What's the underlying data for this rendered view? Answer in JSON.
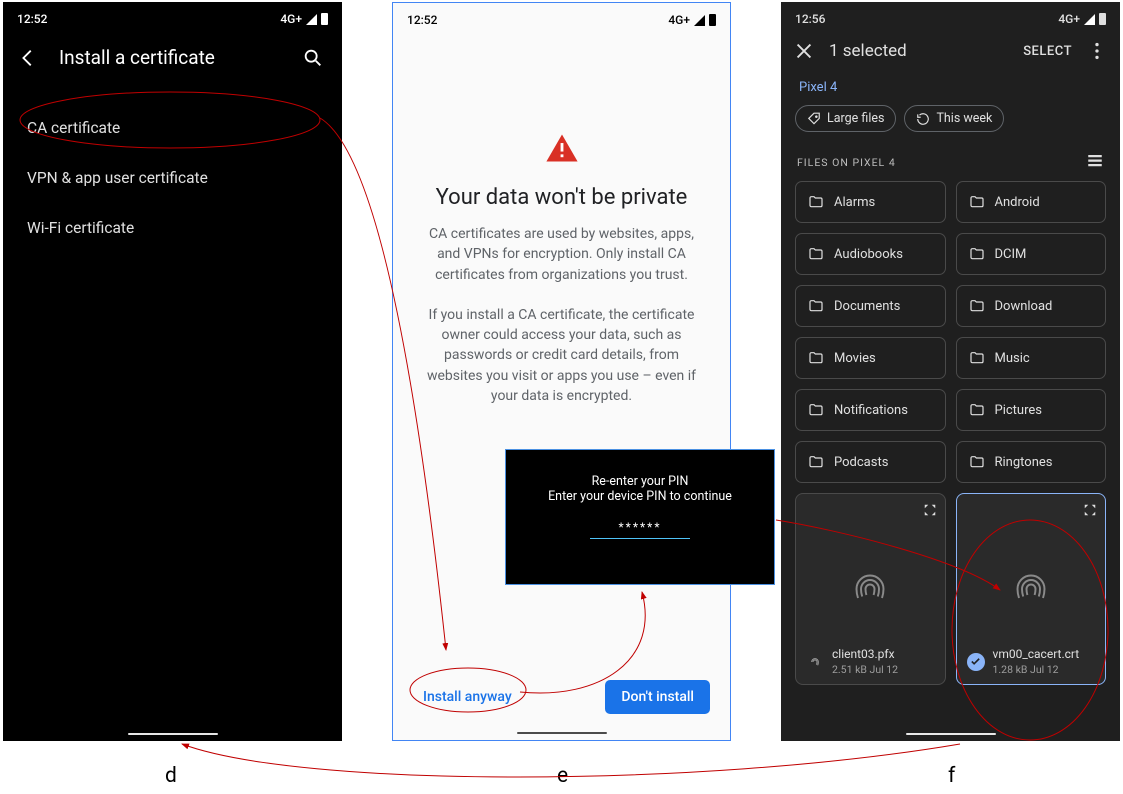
{
  "annotations": {
    "d": "d",
    "e": "e",
    "f": "f"
  },
  "screen_d": {
    "time": "12:52",
    "net": "4G+",
    "title": "Install a certificate",
    "items": [
      "CA certificate",
      "VPN & app user certificate",
      "Wi-Fi certificate"
    ]
  },
  "screen_e": {
    "time": "12:52",
    "net": "4G+",
    "heading": "Your data won't be private",
    "p1": "CA certificates are used by websites, apps, and VPNs for encryption. Only install CA certificates from organizations you trust.",
    "p2": "If you install a CA certificate, the certificate owner could access your data, such as passwords or credit card details, from websites you visit or apps you use – even if your data is encrypted.",
    "install_anyway": "Install anyway",
    "dont_install": "Don't install",
    "pin": {
      "title": "Re-enter your PIN",
      "sub": "Enter your device PIN to continue",
      "masked": "******"
    }
  },
  "screen_f": {
    "time": "12:56",
    "net": "4G+",
    "title": "1 selected",
    "select_action": "SELECT",
    "breadcrumb": "Pixel 4",
    "chips": [
      "Large files",
      "This week"
    ],
    "section": "FILES ON PIXEL 4",
    "folders": [
      "Alarms",
      "Android",
      "Audiobooks",
      "DCIM",
      "Documents",
      "Download",
      "Movies",
      "Music",
      "Notifications",
      "Pictures",
      "Podcasts",
      "Ringtones"
    ],
    "files": [
      {
        "name": "client03.pfx",
        "meta": "2.51 kB Jul 12",
        "selected": false
      },
      {
        "name": "vm00_cacert.crt",
        "meta": "1.28 kB Jul 12",
        "selected": true
      }
    ]
  }
}
